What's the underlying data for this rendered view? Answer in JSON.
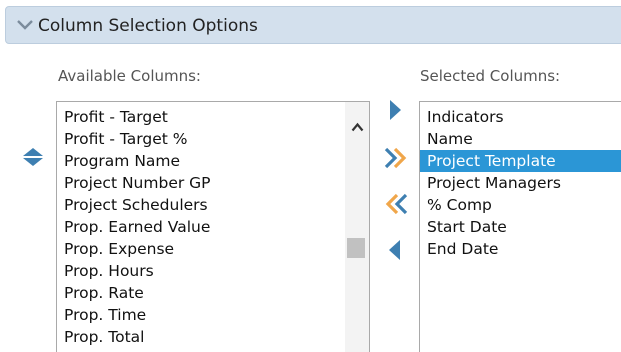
{
  "header": {
    "title": "Column Selection Options",
    "chevron_icon": "chevron-down-icon"
  },
  "available": {
    "label": "Available Columns:",
    "items": [
      "Profit - Target",
      "Profit - Target %",
      "Program Name",
      "Project Number GP",
      "Project Schedulers",
      "Prop. Earned Value",
      "Prop. Expense",
      "Prop. Hours",
      "Prop. Rate",
      "Prop. Time",
      "Prop. Total"
    ]
  },
  "selected": {
    "label": "Selected Columns:",
    "items": [
      "Indicators",
      "Name",
      "Project Template",
      "Project Managers",
      "% Comp",
      "Start Date",
      "End Date"
    ],
    "highlighted": "Project Template"
  },
  "controls": {
    "move_up_down_icon": "move-up-down-icon",
    "add_icon": "arrow-right-icon",
    "add_all_icon": "double-arrow-right-icon",
    "remove_all_icon": "double-arrow-left-icon",
    "remove_icon": "arrow-left-icon"
  },
  "colors": {
    "header_bg": "#d3e0ed",
    "arrow_blue": "#3e7fb1",
    "arrow_orange": "#f0a64a",
    "selection": "#2b96d6"
  }
}
